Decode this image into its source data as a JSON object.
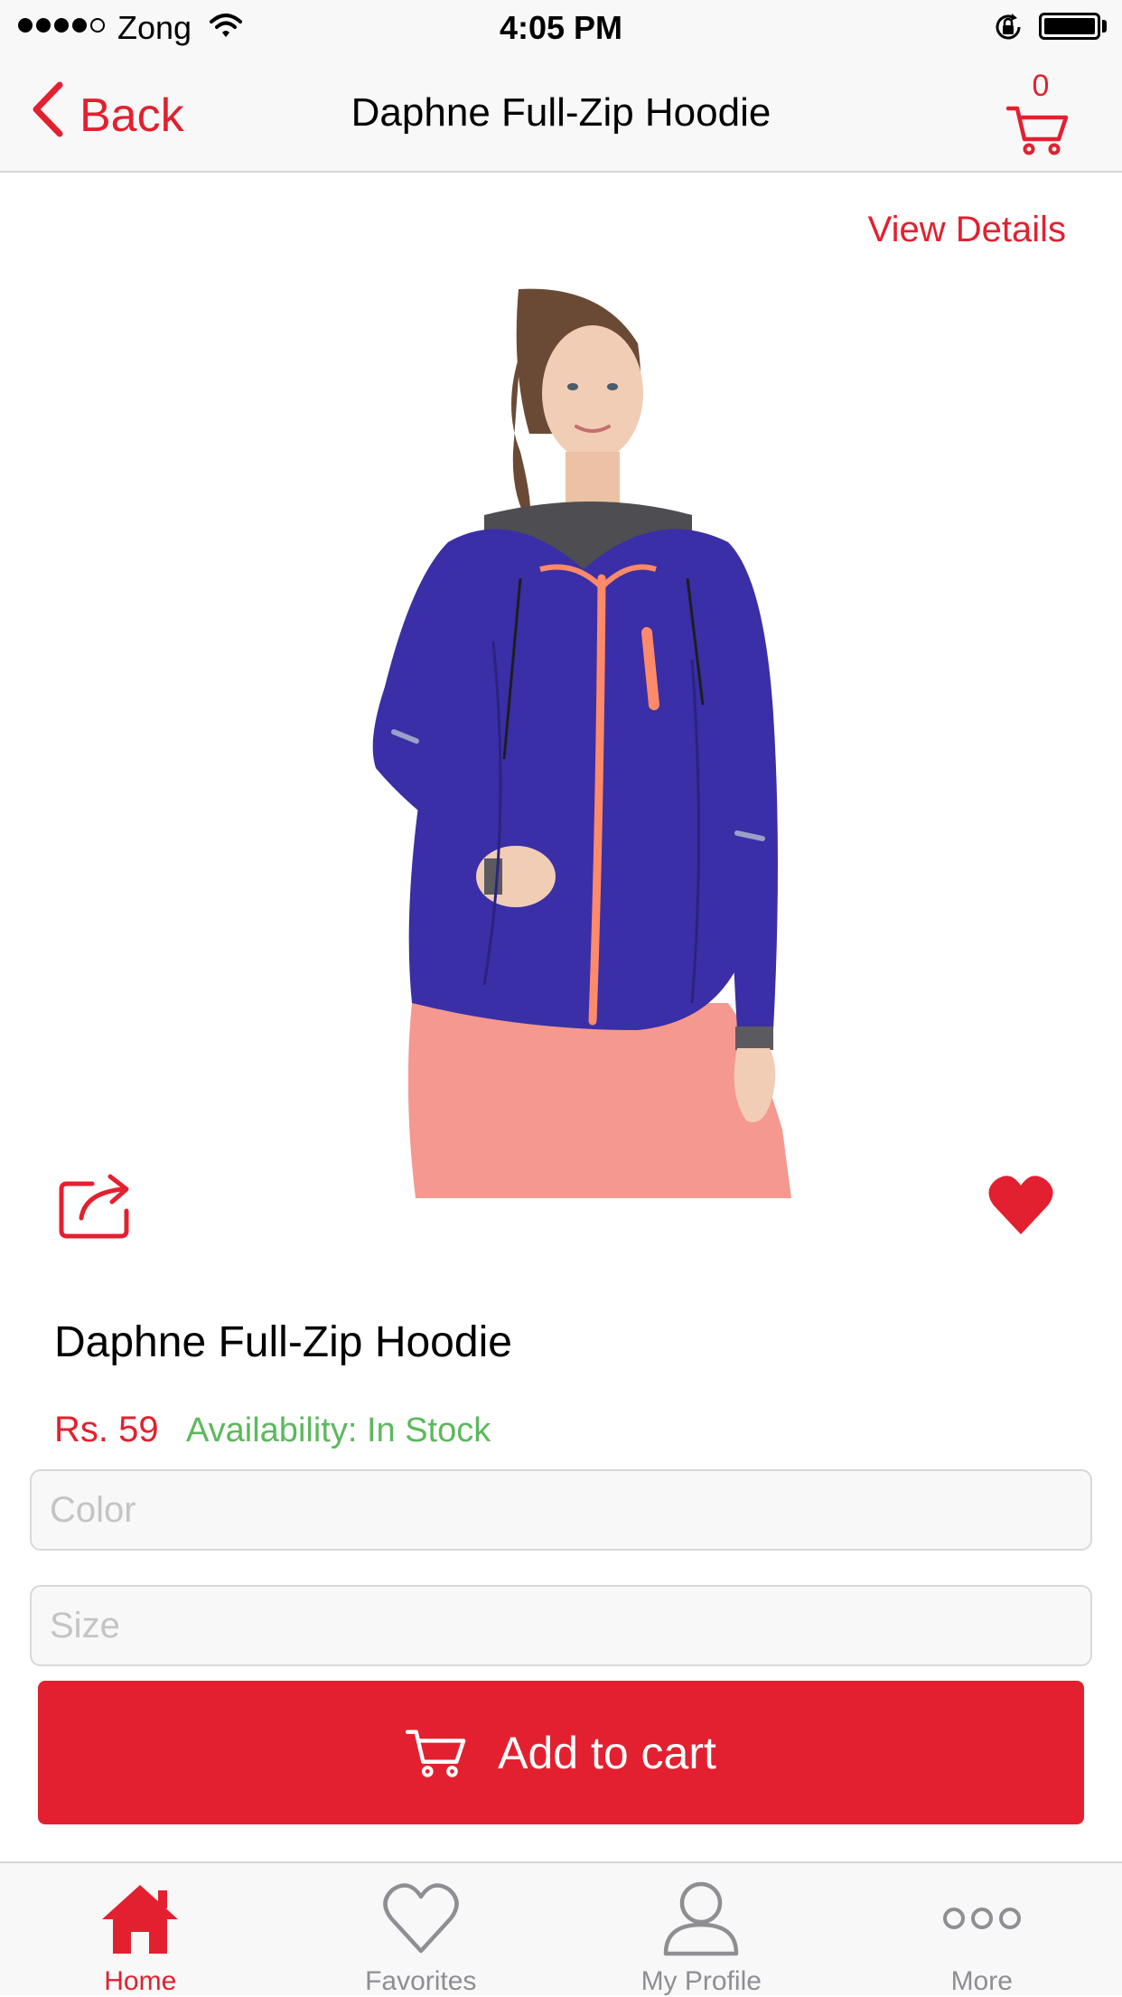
{
  "status_bar": {
    "carrier": "Zong",
    "time": "4:05 PM",
    "signal_bars": 4,
    "signal_total": 5
  },
  "nav": {
    "back_label": "Back",
    "title": "Daphne Full-Zip Hoodie",
    "cart_count": "0"
  },
  "product": {
    "view_details_label": "View Details",
    "name": "Daphne Full-Zip Hoodie",
    "price": "Rs. 59",
    "availability": "Availability: In Stock",
    "favorited": true
  },
  "options": {
    "color_placeholder": "Color",
    "size_placeholder": "Size"
  },
  "add_to_cart_label": "Add to cart",
  "tabs": [
    {
      "label": "Home",
      "icon": "home-icon",
      "active": true
    },
    {
      "label": "Favorites",
      "icon": "heart-outline-icon",
      "active": false
    },
    {
      "label": "My Profile",
      "icon": "profile-icon",
      "active": false
    },
    {
      "label": "More",
      "icon": "more-icon",
      "active": false
    }
  ],
  "colors": {
    "accent": "#e3202f",
    "in_stock": "#5cb85c",
    "tab_inactive": "#8e8e93",
    "hoodie": "#3a2fa6",
    "zipper": "#ff8a6a",
    "pants": "#f59890"
  }
}
